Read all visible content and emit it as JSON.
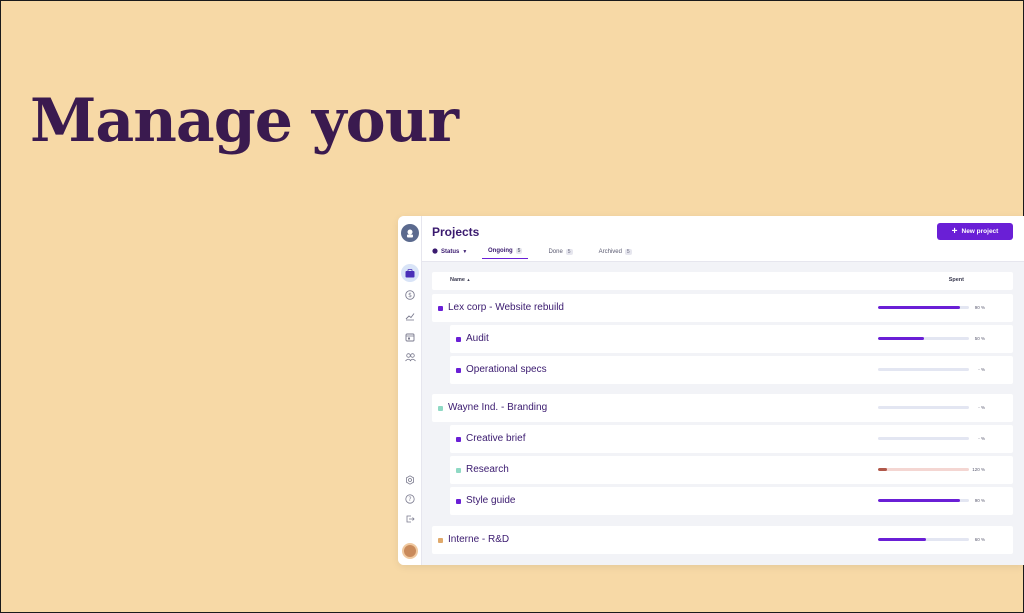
{
  "hero": {
    "title": "Manage your"
  },
  "app": {
    "title": "Projects",
    "new_button": "New project",
    "status_filter": "Status",
    "tabs": [
      {
        "label": "Ongoing",
        "count": "5",
        "active": true
      },
      {
        "label": "Done",
        "count": "5",
        "active": false
      },
      {
        "label": "Archived",
        "count": "5",
        "active": false
      }
    ],
    "columns": {
      "name": "Name",
      "spent": "Spent"
    },
    "sidebar_icons": [
      "briefcase-icon",
      "dollar-icon",
      "chart-icon",
      "calendar-icon",
      "team-icon",
      "settings-icon",
      "help-icon",
      "logout-icon"
    ],
    "rows": [
      {
        "name": "Lex corp - Website rebuild",
        "level": "parent",
        "dot": "#6a1fd6",
        "spent": 90,
        "label": "90 %",
        "bar": "#6a1fd6",
        "track": "#e3e6f2"
      },
      {
        "name": "Audit",
        "level": "child",
        "dot": "#6a1fd6",
        "spent": 50,
        "label": "50 %",
        "bar": "#6a1fd6",
        "track": "#e3e6f2"
      },
      {
        "name": "Operational specs",
        "level": "child",
        "dot": "#6a1fd6",
        "spent": 0,
        "label": "- %",
        "bar": "#6a1fd6",
        "track": "#e3e6f2"
      },
      {
        "name": "Wayne Ind. - Branding",
        "level": "parent",
        "dot": "#8fd9c4",
        "spent": 0,
        "label": "- %",
        "bar": "#6a1fd6",
        "track": "#e3e6f2"
      },
      {
        "name": "Creative brief",
        "level": "child",
        "dot": "#6a1fd6",
        "spent": 0,
        "label": "- %",
        "bar": "#6a1fd6",
        "track": "#e3e6f2"
      },
      {
        "name": "Research",
        "level": "child",
        "dot": "#8fd9c4",
        "spent": 10,
        "label": "120 %",
        "bar": "#b0584a",
        "track": "#f4d6d2"
      },
      {
        "name": "Style guide",
        "level": "child",
        "dot": "#6a1fd6",
        "spent": 90,
        "label": "90 %",
        "bar": "#6a1fd6",
        "track": "#e3e6f2"
      },
      {
        "name": "Interne - R&D",
        "level": "parent",
        "dot": "#e0a96b",
        "spent": 53,
        "label": "60 %",
        "bar": "#6a1fd6",
        "track": "#e3e6f2"
      }
    ]
  },
  "colors": {
    "background": "#f7d9a6",
    "accent": "#6a1fd6",
    "title": "#3a1a4f"
  }
}
